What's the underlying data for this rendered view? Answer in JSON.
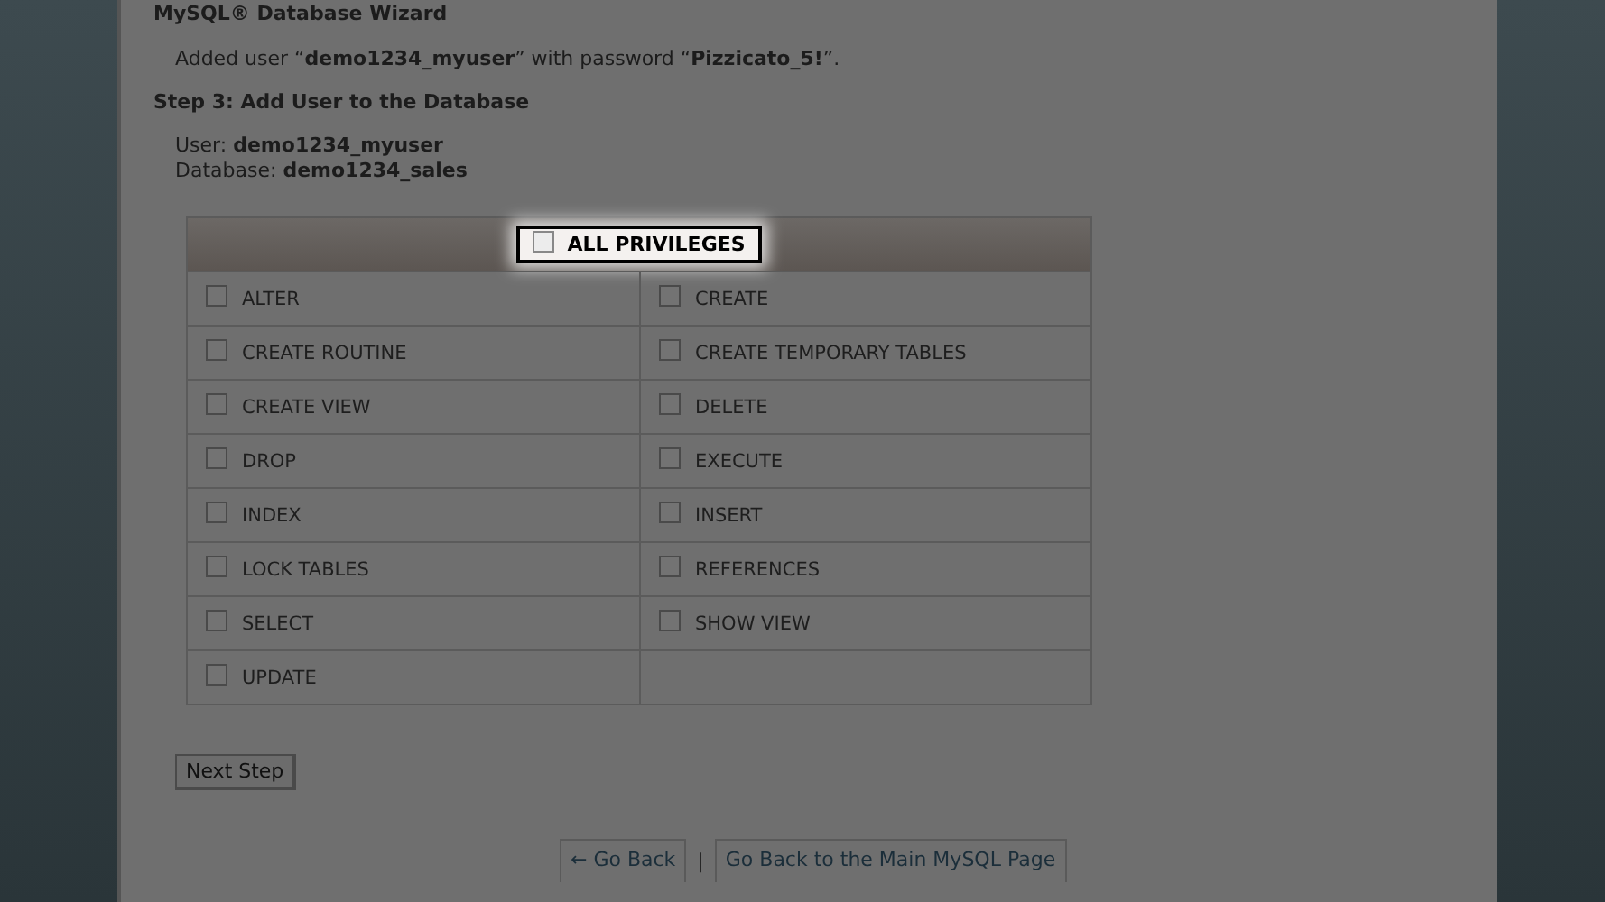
{
  "page_title": "MySQL® Database Wizard",
  "message": "Added user “**demo1234_myuser**” with password “**Pizzicato_5!**”.",
  "step_title": "Step 3: Add User to the Database",
  "details": [
    "User: **demo1234_myuser**",
    "Database: **demo1234_sales**"
  ],
  "all_privileges": {
    "label": "ALL PRIVILEGES",
    "checked": false
  },
  "privileges": [
    {
      "label": "ALTER",
      "checked": false
    },
    {
      "label": "CREATE",
      "checked": false
    },
    {
      "label": "CREATE ROUTINE",
      "checked": false
    },
    {
      "label": "CREATE TEMPORARY TABLES",
      "checked": false
    },
    {
      "label": "CREATE VIEW",
      "checked": false
    },
    {
      "label": "DELETE",
      "checked": false
    },
    {
      "label": "DROP",
      "checked": false
    },
    {
      "label": "EXECUTE",
      "checked": false
    },
    {
      "label": "INDEX",
      "checked": false
    },
    {
      "label": "INSERT",
      "checked": false
    },
    {
      "label": "LOCK TABLES",
      "checked": false
    },
    {
      "label": "REFERENCES",
      "checked": false
    },
    {
      "label": "SELECT",
      "checked": false
    },
    {
      "label": "SHOW VIEW",
      "checked": false
    },
    {
      "label": "UPDATE",
      "checked": false
    }
  ],
  "next_button": "Next Step",
  "back_link": "← Go Back",
  "separator": "|",
  "main_link": "Go Back to the Main MySQL Page"
}
